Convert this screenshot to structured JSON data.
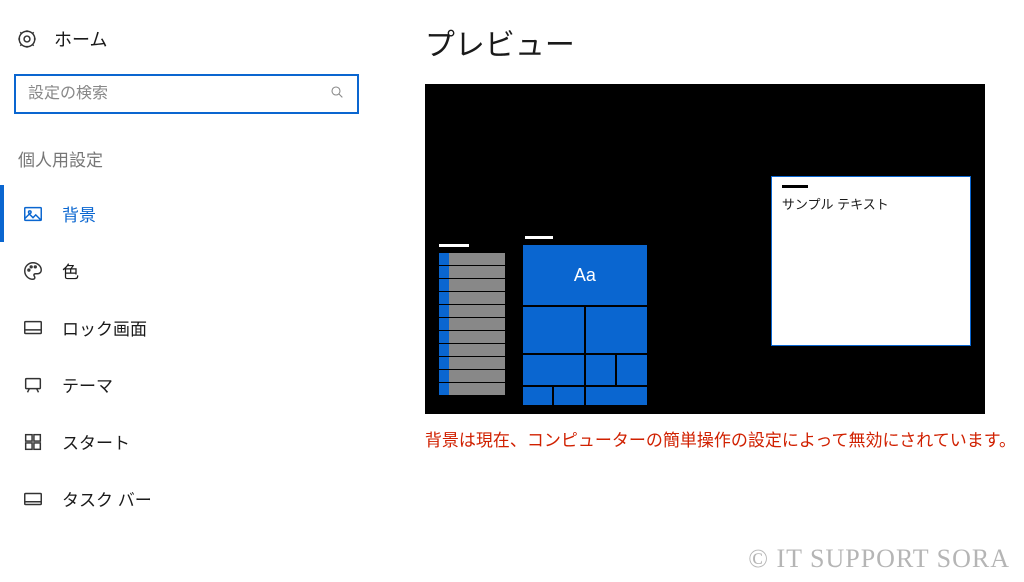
{
  "sidebar": {
    "home_label": "ホーム",
    "search_placeholder": "設定の検索",
    "section_label": "個人用設定",
    "items": [
      {
        "label": "背景"
      },
      {
        "label": "色"
      },
      {
        "label": "ロック画面"
      },
      {
        "label": "テーマ"
      },
      {
        "label": "スタート"
      },
      {
        "label": "タスク バー"
      }
    ]
  },
  "main": {
    "title": "プレビュー",
    "sample_text": "サンプル テキスト",
    "tile_text": "Aa",
    "warning": "背景は現在、コンピューターの簡単操作の設定によって無効にされています。"
  },
  "watermark": "© IT SUPPORT SORA"
}
